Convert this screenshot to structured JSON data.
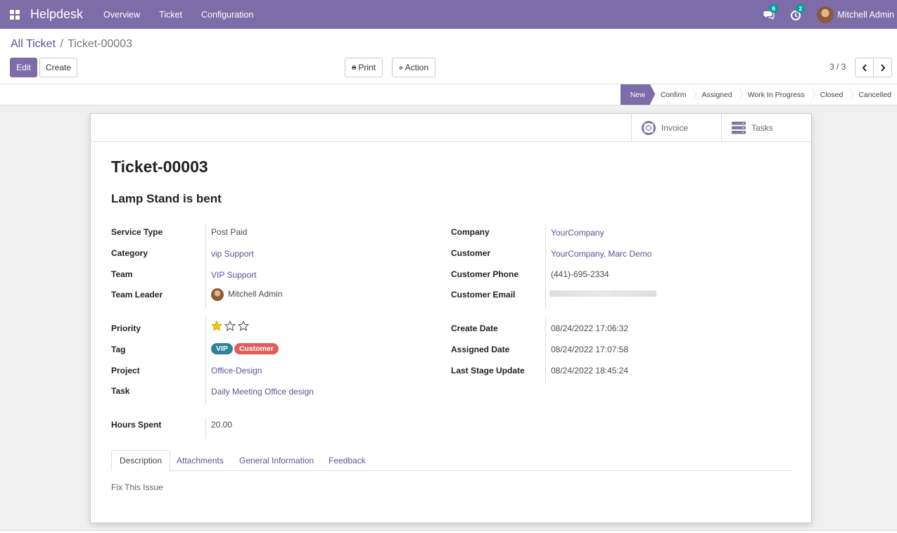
{
  "navbar": {
    "brand": "Helpdesk",
    "menu": [
      "Overview",
      "Ticket",
      "Configuration"
    ],
    "messages_badge": "6",
    "activities_badge": "2",
    "user": "Mitchell Admin"
  },
  "control": {
    "breadcrumb_parent": "All Ticket",
    "breadcrumb_sep": "/",
    "breadcrumb_current": "Ticket-00003",
    "edit_label": "Edit",
    "create_label": "Create",
    "print_label": "Print",
    "action_label": "Action",
    "pager": "3 / 3"
  },
  "stages": [
    "New",
    "Confirm",
    "Assigned",
    "Work In Progress",
    "Closed",
    "Cancelled"
  ],
  "active_stage": "New",
  "smart_buttons": {
    "invoice": "Invoice",
    "tasks": "Tasks"
  },
  "ticket": {
    "number": "Ticket-00003",
    "subject": "Lamp Stand is bent"
  },
  "left_fields": {
    "service_type_label": "Service Type",
    "service_type": "Post Paid",
    "category_label": "Category",
    "category": "vip Support",
    "team_label": "Team",
    "team": "VIP Support",
    "team_leader_label": "Team Leader",
    "team_leader": "Mitchell Admin",
    "priority_label": "Priority",
    "priority_stars": 1,
    "priority_max": 3,
    "tag_label": "Tag",
    "tags": [
      "VIP",
      "Customer"
    ],
    "project_label": "Project",
    "project": "Office-Design",
    "task_label": "Task",
    "task": "Daily Meeting Office design",
    "hours_label": "Hours Spent",
    "hours": "20.00"
  },
  "right_fields": {
    "company_label": "Company",
    "company": "YourCompany",
    "customer_label": "Customer",
    "customer": "YourCompany, Marc Demo",
    "phone_label": "Customer Phone",
    "phone": "(441)-695-2334",
    "email_label": "Customer Email",
    "create_date_label": "Create Date",
    "create_date": "08/24/2022 17:06:32",
    "assigned_date_label": "Assigned Date",
    "assigned_date": "08/24/2022 17:07:58",
    "last_stage_label": "Last Stage Update",
    "last_stage": "08/24/2022 18:45:24"
  },
  "tabs": [
    "Description",
    "Attachments",
    "General Information",
    "Feedback"
  ],
  "active_tab": "Description",
  "description": "Fix This Issue",
  "colors": {
    "brand": "#7c6ca8",
    "link": "#5f5190",
    "badge": "#00a09d",
    "tag_vip": "#30809a",
    "tag_customer": "#e15d5d",
    "star": "#f3cc00"
  }
}
